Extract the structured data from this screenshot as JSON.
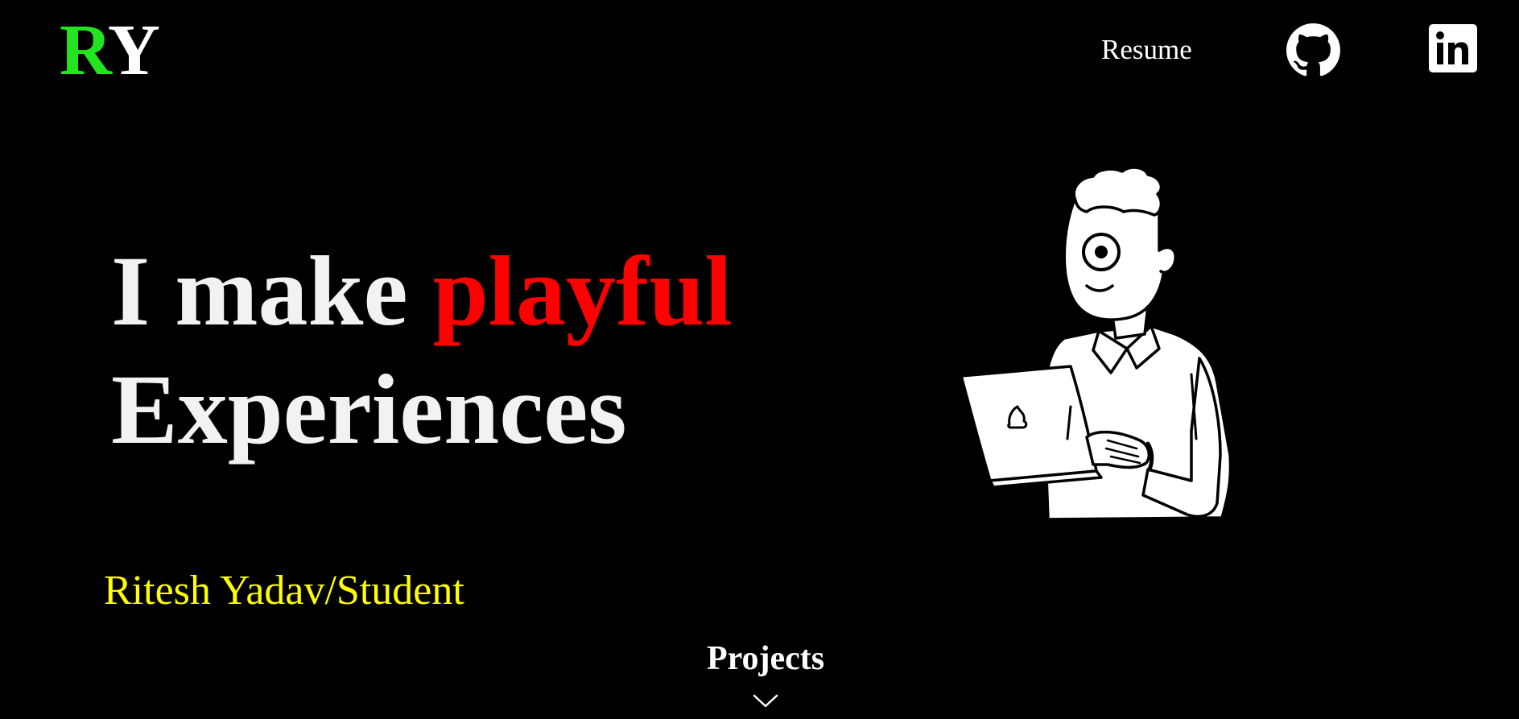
{
  "header": {
    "logo_first": "R",
    "logo_second": "Y",
    "nav_resume": "Resume"
  },
  "hero": {
    "line1_prefix": "I make ",
    "line1_accent": "playful",
    "line2": "Experiences",
    "subtitle": "Ritesh Yadav/Student"
  },
  "footer": {
    "projects_label": "Projects"
  },
  "icons": {
    "github": "github-icon",
    "linkedin": "linkedin-icon",
    "chevron": "chevron-down-icon"
  },
  "colors": {
    "background": "#000000",
    "logo_r": "#22e51f",
    "accent": "#ff0000",
    "subtitle": "#ffff00",
    "text": "#ffffff"
  }
}
